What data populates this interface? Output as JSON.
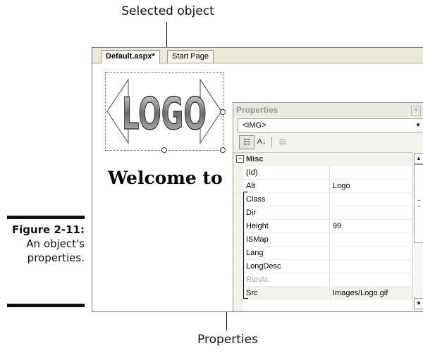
{
  "callouts": {
    "top": "Selected object",
    "bottom": "Properties"
  },
  "figure": {
    "number": "Figure 2-11:",
    "caption_line1": "An object's",
    "caption_line2": "properties."
  },
  "editor": {
    "tabs": [
      {
        "label": "Default.aspx*",
        "active": true
      },
      {
        "label": "Start Page",
        "active": false
      }
    ],
    "logo_text": "LOGO",
    "welcome_text": "Welcome to"
  },
  "properties_panel": {
    "title": "Properties",
    "close_glyph": "×",
    "object_selector": "<IMG>",
    "dropdown_glyph": "▼",
    "toolbar": {
      "categorized_glyph": "☷",
      "alphabetical_glyph": "A↓",
      "pages_glyph": "▤"
    },
    "category": {
      "expander": "−",
      "name": "Misc"
    },
    "rows": [
      {
        "name": "(Id)",
        "value": "",
        "disabled": false
      },
      {
        "name": "Alt",
        "value": "Logo",
        "disabled": false
      },
      {
        "name": "Class",
        "value": "",
        "disabled": false
      },
      {
        "name": "Dir",
        "value": "",
        "disabled": false
      },
      {
        "name": "Height",
        "value": "99",
        "disabled": false
      },
      {
        "name": "ISMap",
        "value": "",
        "disabled": false
      },
      {
        "name": "Lang",
        "value": "",
        "disabled": false
      },
      {
        "name": "LongDesc",
        "value": "",
        "disabled": false
      },
      {
        "name": "RunAt",
        "value": "",
        "disabled": true
      },
      {
        "name": "Src",
        "value": "Images/Logo.gif",
        "disabled": false
      }
    ],
    "scroll_up_glyph": "▲",
    "scroll_down_glyph": "▼"
  },
  "colors": {
    "window_chrome": "#ece9d8",
    "panel_background": "#f3f3ee",
    "title_text_inactive": "#9a9a9a"
  }
}
